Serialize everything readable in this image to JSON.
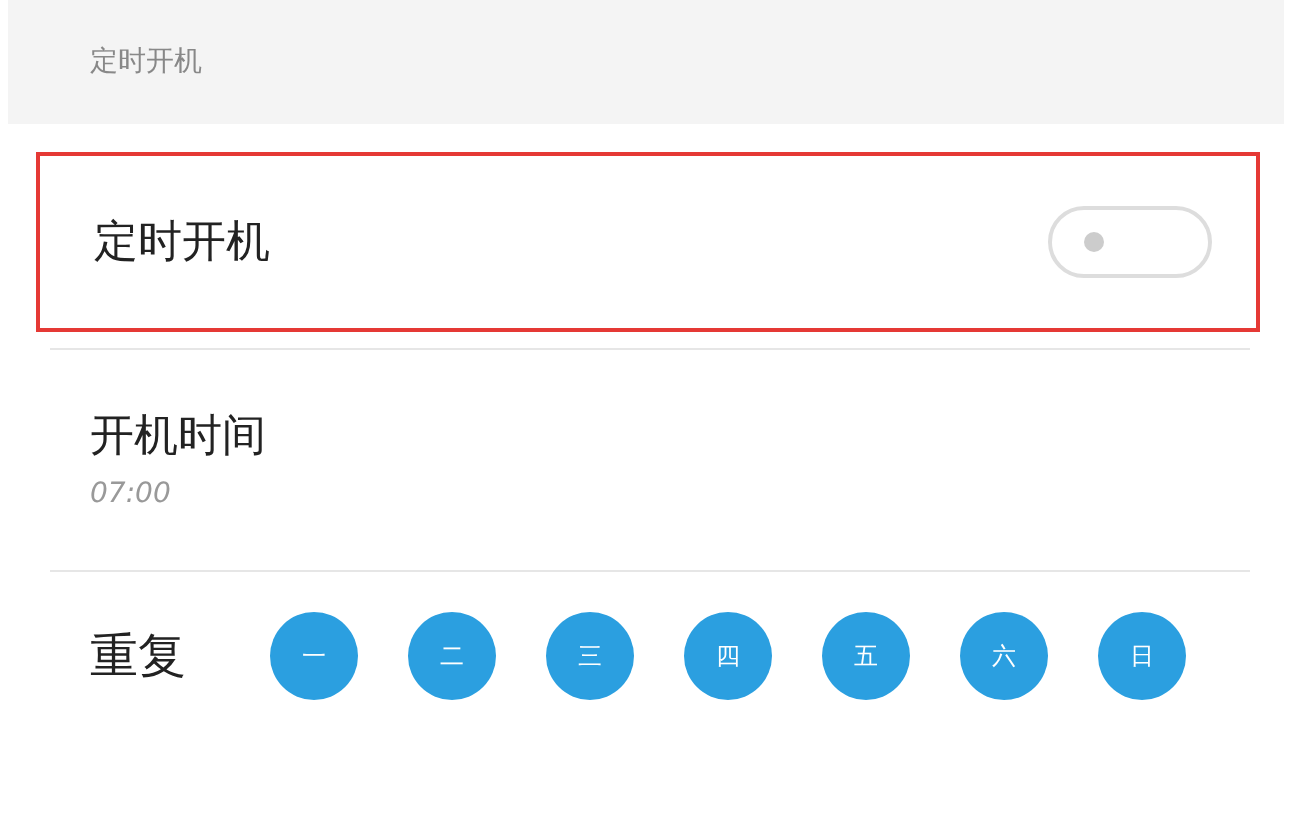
{
  "section_header": "定时开机",
  "power_on_row": {
    "label": "定时开机",
    "on": false,
    "highlighted": true
  },
  "time_row": {
    "label": "开机时间",
    "value": "07:00"
  },
  "repeat": {
    "label": "重复",
    "days": [
      {
        "label": "一",
        "selected": true
      },
      {
        "label": "二",
        "selected": true
      },
      {
        "label": "三",
        "selected": true
      },
      {
        "label": "四",
        "selected": true
      },
      {
        "label": "五",
        "selected": true
      },
      {
        "label": "六",
        "selected": true
      },
      {
        "label": "日",
        "selected": true
      }
    ]
  }
}
